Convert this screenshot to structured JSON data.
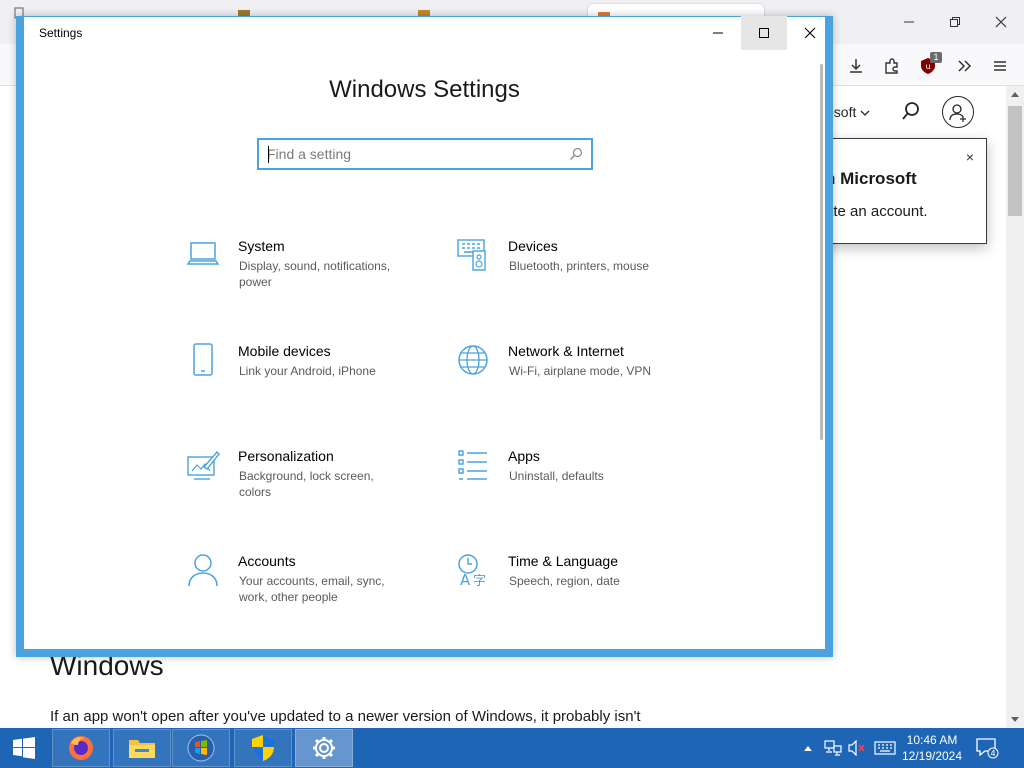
{
  "browser": {
    "nav_partial": "osoft",
    "popup": {
      "title": "n Microsoft",
      "text": "ate an account.",
      "close_glyph": "×"
    },
    "extension_badge": "1",
    "article": {
      "heading": "Windows",
      "paragraph": "If an app won't open after you've updated to a newer version of Windows, it probably isn't"
    }
  },
  "settings": {
    "window_title": "Settings",
    "heading": "Windows Settings",
    "search_placeholder": "Find a setting",
    "tiles": [
      {
        "title": "System",
        "desc": "Display, sound, notifications, power",
        "icon": "laptop-icon"
      },
      {
        "title": "Devices",
        "desc": "Bluetooth, printers, mouse",
        "icon": "devices-icon"
      },
      {
        "title": "Mobile devices",
        "desc": "Link your Android, iPhone",
        "icon": "phone-icon"
      },
      {
        "title": "Network & Internet",
        "desc": "Wi-Fi, airplane mode, VPN",
        "icon": "globe-icon"
      },
      {
        "title": "Personalization",
        "desc": "Background, lock screen, colors",
        "icon": "paint-icon"
      },
      {
        "title": "Apps",
        "desc": "Uninstall, defaults",
        "icon": "apps-list-icon"
      },
      {
        "title": "Accounts",
        "desc": "Your accounts, email, sync, work, other people",
        "icon": "person-icon"
      },
      {
        "title": "Time & Language",
        "desc": "Speech, region, date",
        "icon": "time-language-icon"
      }
    ]
  },
  "taskbar": {
    "time": "10:46 AM",
    "date": "12/19/2024",
    "notification_count": "4"
  },
  "colors": {
    "accent": "#4aa3df",
    "taskbar": "#1e65b5"
  }
}
